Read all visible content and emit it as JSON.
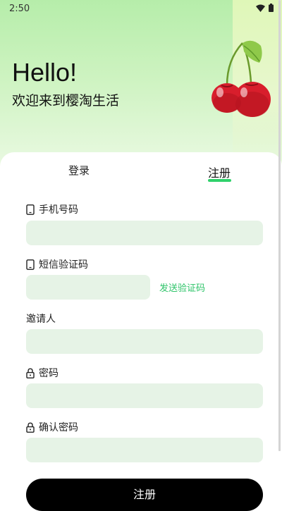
{
  "status_bar": {
    "time": "2:50",
    "wifi_icon": "wifi-icon",
    "battery_icon": "battery-icon"
  },
  "hero": {
    "greeting": "Hello!",
    "welcome": "欢迎来到樱淘生活",
    "illustration_icon": "cherry-icon"
  },
  "tabs": [
    {
      "label": "登录",
      "active": false
    },
    {
      "label": "注册",
      "active": true
    }
  ],
  "form": {
    "phone": {
      "label": "手机号码",
      "icon": "phone-icon",
      "value": ""
    },
    "sms_code": {
      "label": "短信验证码",
      "icon": "phone-icon",
      "value": "",
      "send_label": "发送验证码"
    },
    "inviter": {
      "label": "邀请人",
      "value": ""
    },
    "password": {
      "label": "密码",
      "icon": "lock-icon",
      "value": ""
    },
    "confirm_password": {
      "label": "确认密码",
      "icon": "lock-icon",
      "value": ""
    }
  },
  "submit_label": "注册",
  "colors": {
    "accent": "#2fd16b",
    "input_bg": "#e6f3e6",
    "button_bg": "#000000",
    "cherry_red": "#d81e2c"
  }
}
